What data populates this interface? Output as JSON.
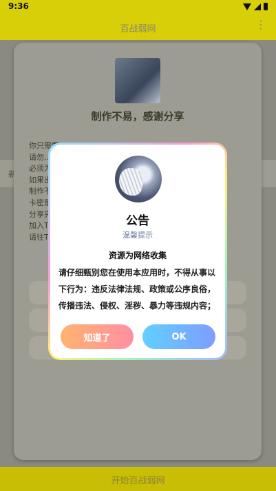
{
  "status_bar": {
    "time": "9:36"
  },
  "app_bar": {
    "title": "百战弱网",
    "more_icon": "⋮"
  },
  "background": {
    "side_label": "新",
    "card_heading": "制作不易，感谢分享",
    "card_lines": [
      "你只需要",
      "请勿...",
      "必须为...",
      "如果出...",
      "制作不...",
      "卡密是...",
      "分享完...",
      "加入T...",
      "请往T..."
    ],
    "bottom_button": "开始百战弱网"
  },
  "dialog": {
    "title": "公告",
    "subtitle": "温馨提示",
    "heading": "资源为网络收集",
    "body": "请仔细甄别您在使用本应用时，不得从事以下行为：违反法律法规、政策或公序良俗，传播违法、侵权、淫秽、暴力等违规内容；",
    "button_know": "知道了",
    "button_ok": "OK"
  }
}
